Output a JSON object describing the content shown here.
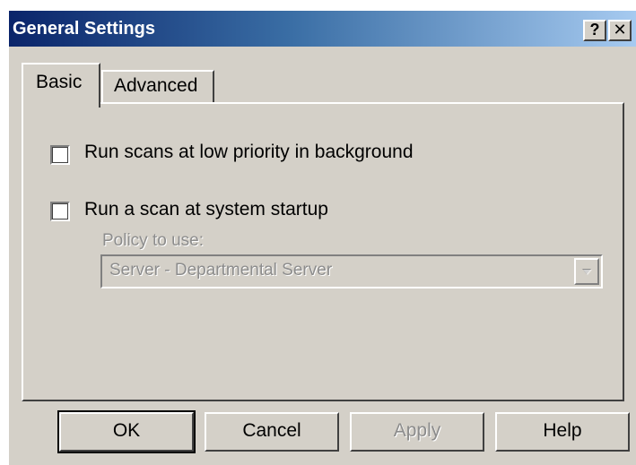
{
  "window": {
    "title": "General Settings",
    "help_button": "?",
    "close_button": "✕"
  },
  "tabs": [
    {
      "label": "Basic",
      "selected": true
    },
    {
      "label": "Advanced",
      "selected": false
    }
  ],
  "basic": {
    "option_low_priority": {
      "label": "Run scans at low priority in background",
      "checked": false
    },
    "option_startup": {
      "label": "Run a scan at system startup",
      "checked": false
    },
    "policy": {
      "label": "Policy to use:",
      "value": "Server - Departmental Server",
      "enabled": false
    }
  },
  "buttons": {
    "ok": "OK",
    "cancel": "Cancel",
    "apply": "Apply",
    "help": "Help"
  },
  "colors": {
    "face": "#d4d0c8",
    "title_start": "#0a246a",
    "title_end": "#a6caf0",
    "disabled_text": "#8c8c8c"
  }
}
